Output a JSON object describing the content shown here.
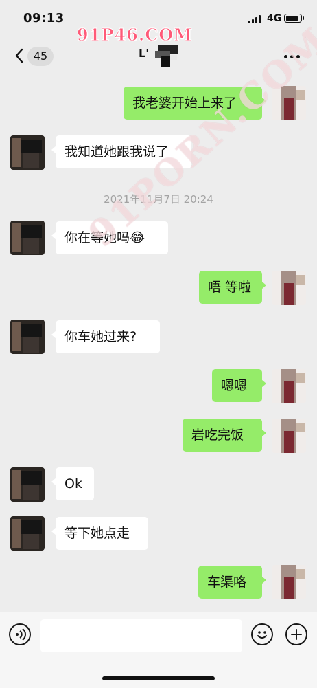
{
  "status_bar": {
    "time": "09:13",
    "network": "4G",
    "signal_bars": 4,
    "battery_level": 0.85
  },
  "watermarks": {
    "top": "91P46.COM",
    "diagonal": "91PORN.COM"
  },
  "nav": {
    "unread_count": "45",
    "chat_title": "L'",
    "back_icon": "chevron-left-icon",
    "more_icon": "ellipsis-icon"
  },
  "messages": [
    {
      "side": "out",
      "text": "我老婆开始上来了"
    },
    {
      "side": "in",
      "text": "我知道她跟我说了"
    },
    {
      "side": "in",
      "text": "你在等她吗😂"
    },
    {
      "side": "out",
      "text": "唔 等啦"
    },
    {
      "side": "in",
      "text": "你车她过来?"
    },
    {
      "side": "out",
      "text": "嗯嗯"
    },
    {
      "side": "out",
      "text": "岩吃完饭"
    },
    {
      "side": "in",
      "text": "Ok"
    },
    {
      "side": "in",
      "text": "等下她点走"
    },
    {
      "side": "out",
      "text": "车渠咯"
    }
  ],
  "timestamp": "2021年11月7日 20:24",
  "input_bar": {
    "voice_icon": "voice-icon",
    "emoji_icon": "emoji-icon",
    "plus_icon": "plus-icon"
  },
  "colors": {
    "background": "#ededed",
    "outgoing_bubble": "#95ec69",
    "incoming_bubble": "#ffffff"
  }
}
